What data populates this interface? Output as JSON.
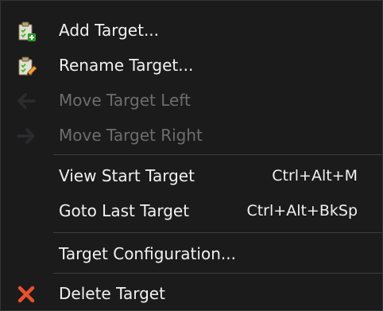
{
  "menu": {
    "items": [
      {
        "label": "Add Target...",
        "icon": "clipboard-add-icon",
        "enabled": true
      },
      {
        "label": "Rename Target...",
        "icon": "clipboard-edit-icon",
        "enabled": true
      },
      {
        "label": "Move Target Left",
        "icon": "arrow-left-icon",
        "enabled": false
      },
      {
        "label": "Move Target Right",
        "icon": "arrow-right-icon",
        "enabled": false
      },
      {
        "label": "View Start Target",
        "shortcut": "Ctrl+Alt+M",
        "enabled": true
      },
      {
        "label": "Goto Last Target",
        "shortcut": "Ctrl+Alt+BkSp",
        "enabled": true
      },
      {
        "label": "Target Configuration...",
        "enabled": true
      },
      {
        "label": "Delete Target",
        "icon": "delete-x-icon",
        "enabled": true
      }
    ]
  },
  "colors": {
    "background": "#1b1b1c",
    "text": "#f1f1f1",
    "disabled_text": "#6d6d6d",
    "separator": "#3f3f42",
    "delete_icon": "#e8512c",
    "check_green": "#46b832"
  }
}
